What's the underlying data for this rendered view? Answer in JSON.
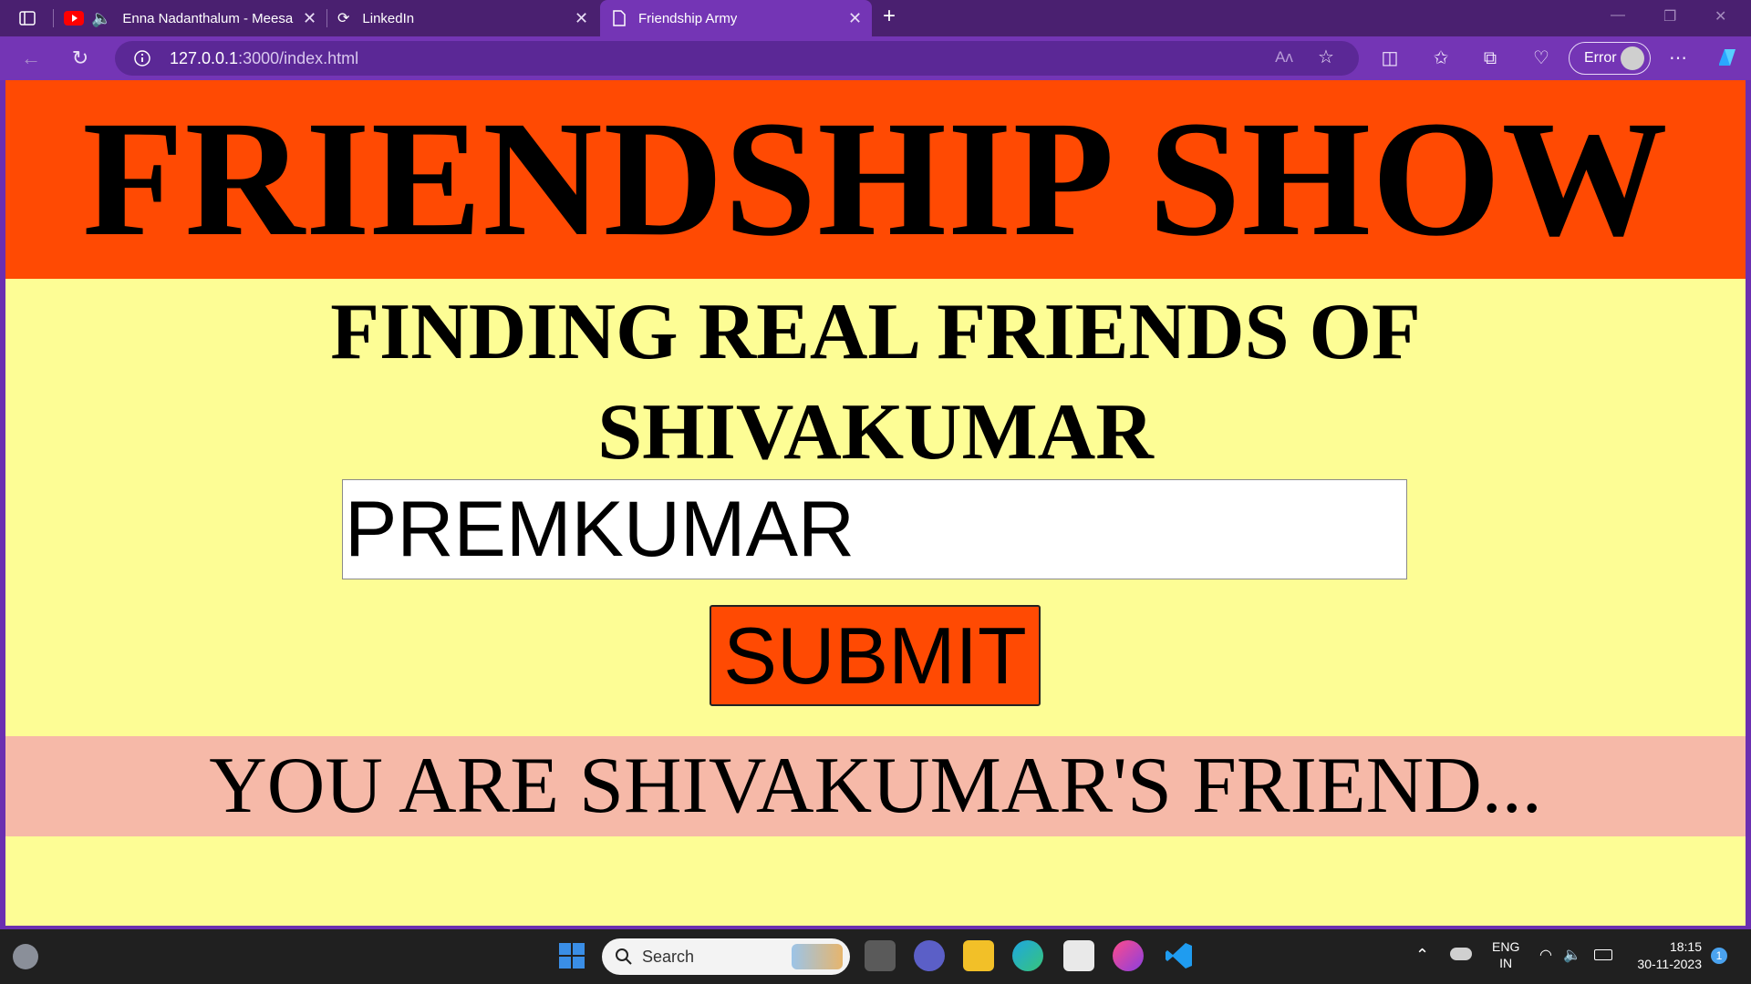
{
  "browser": {
    "tabs": [
      {
        "label": "Enna Nadanthalum - Meesa"
      },
      {
        "label": "LinkedIn"
      },
      {
        "label": "Friendship Army"
      }
    ],
    "url_host": "127.0.0.1",
    "url_rest": ":3000/index.html",
    "error_label": "Error"
  },
  "page": {
    "banner_title": "FRIENDSHIP SHOW",
    "subtitle_line1": "FINDING REAL FRIENDS OF",
    "subtitle_line2": "SHIVAKUMAR",
    "name_input_value": "PREMKUMAR",
    "submit_label": "SUBMIT",
    "result_text": "YOU ARE SHIVAKUMAR'S FRIEND...",
    "colors": {
      "banner": "#ff4a03",
      "background": "#fdfd95",
      "result_bg": "#f6b9a8"
    }
  },
  "taskbar": {
    "search_label": "Search",
    "lang_line1": "ENG",
    "lang_line2": "IN",
    "time": "18:15",
    "date": "30-11-2023",
    "notification_count": "1"
  }
}
